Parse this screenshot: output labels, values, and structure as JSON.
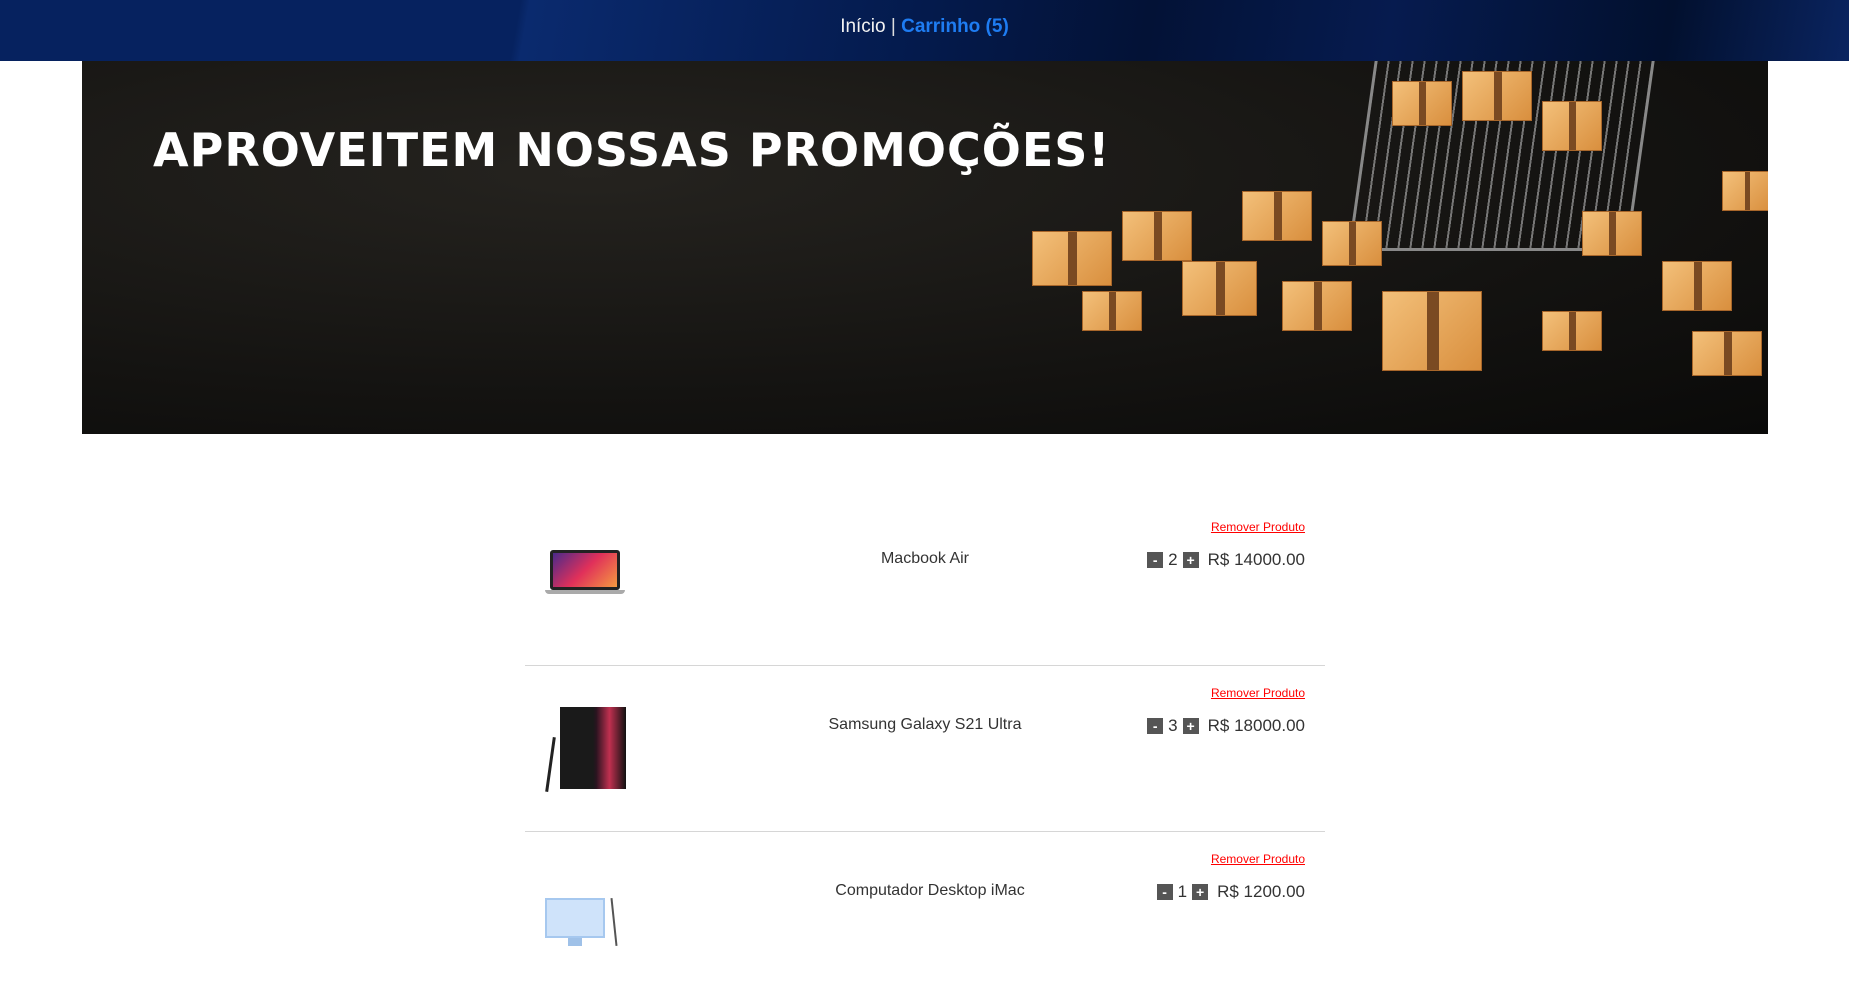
{
  "nav": {
    "home": "Início",
    "separator": "|",
    "cart": "Carrinho (5)"
  },
  "banner": {
    "title": "APROVEITEM NOSSAS PROMOÇÕES!"
  },
  "cart": {
    "items": [
      {
        "name": "Macbook Air",
        "quantity": "2",
        "price": "R$ 14000.00",
        "remove": "Remover Produto",
        "minus": "-",
        "plus": "+"
      },
      {
        "name": "Samsung Galaxy S21 Ultra",
        "quantity": "3",
        "price": "R$ 18000.00",
        "remove": "Remover Produto",
        "minus": "-",
        "plus": "+"
      },
      {
        "name": "Computador Desktop iMac",
        "quantity": "1",
        "price": "R$ 1200.00",
        "remove": "Remover Produto",
        "minus": "-",
        "plus": "+"
      }
    ]
  }
}
